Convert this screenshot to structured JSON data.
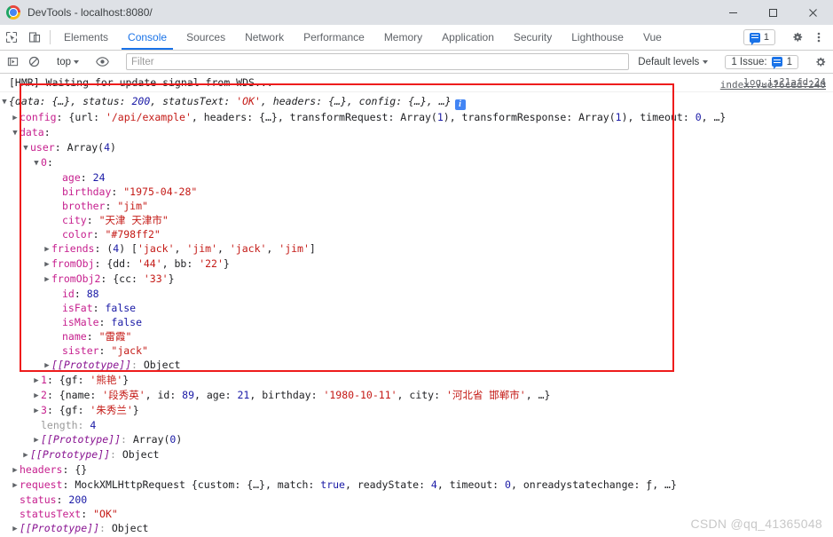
{
  "window": {
    "title": "DevTools - localhost:8080/",
    "minimize_label": "Minimize",
    "maximize_label": "Maximize",
    "close_label": "Close"
  },
  "tabbar": {
    "inspect_icon": "inspect-element-icon",
    "device_icon": "device-toolbar-icon",
    "tabs": [
      {
        "label": "Elements",
        "active": false
      },
      {
        "label": "Console",
        "active": true
      },
      {
        "label": "Sources",
        "active": false
      },
      {
        "label": "Network",
        "active": false
      },
      {
        "label": "Performance",
        "active": false
      },
      {
        "label": "Memory",
        "active": false
      },
      {
        "label": "Application",
        "active": false
      },
      {
        "label": "Security",
        "active": false
      },
      {
        "label": "Lighthouse",
        "active": false
      },
      {
        "label": "Vue",
        "active": false
      }
    ],
    "message_count": "1",
    "settings_icon": "gear-icon",
    "more_icon": "kebab-menu-icon"
  },
  "filterbar": {
    "execute_icon": "execute-snippet-icon",
    "clear_icon": "clear-console-icon",
    "context": "top",
    "eye_icon": "live-expression-icon",
    "filter_placeholder": "Filter",
    "filter_value": "",
    "levels": "Default levels",
    "issues_label": "1 Issue:",
    "issues_count": "1",
    "console_settings_icon": "gear-icon"
  },
  "console": {
    "hmr_message": "[HMR] Waiting for update signal from WDS...",
    "hmr_source": "log.js?1afd:24",
    "object_source": "index.vue?6ced:240",
    "summary": {
      "prefix": "{data: {…}, status: ",
      "status": "200",
      "mid": ", statusText: ",
      "statusText": "'OK'",
      "suffix": ", headers: {…}, config: {…}, …}",
      "info_badge": "i"
    },
    "rows": [
      {
        "indent": 1,
        "arrow": "closed",
        "name": "config",
        "sep": ": ",
        "value": "{url: '/api/example', headers: {…}, transformRequest: Array(1), transformResponse: Array(1), timeout: 0, …}"
      },
      {
        "indent": 1,
        "arrow": "open",
        "name": "data",
        "sep": ":",
        "value": ""
      },
      {
        "indent": 2,
        "arrow": "open",
        "name": "user",
        "sep": ": ",
        "value": "Array(4)"
      },
      {
        "indent": 3,
        "arrow": "open",
        "name": "0",
        "sep": ":",
        "value": ""
      },
      {
        "indent": 5,
        "arrow": "none",
        "name": "age",
        "sep": ": ",
        "value": "24"
      },
      {
        "indent": 5,
        "arrow": "none",
        "name": "birthday",
        "sep": ": ",
        "value": "\"1975-04-28\""
      },
      {
        "indent": 5,
        "arrow": "none",
        "name": "brother",
        "sep": ": ",
        "value": "\"jim\""
      },
      {
        "indent": 5,
        "arrow": "none",
        "name": "city",
        "sep": ": ",
        "value": "\"天津 天津市\""
      },
      {
        "indent": 5,
        "arrow": "none",
        "name": "color",
        "sep": ": ",
        "value": "\"#798ff2\""
      },
      {
        "indent": 4,
        "arrow": "closed",
        "name": "friends",
        "sep": ": ",
        "value": "(4) ['jack', 'jim', 'jack', 'jim']"
      },
      {
        "indent": 4,
        "arrow": "closed",
        "name": "fromObj",
        "sep": ": ",
        "value": "{dd: '44', bb: '22'}"
      },
      {
        "indent": 4,
        "arrow": "closed",
        "name": "fromObj2",
        "sep": ": ",
        "value": "{cc: '33'}"
      },
      {
        "indent": 5,
        "arrow": "none",
        "name": "id",
        "sep": ": ",
        "value": "88"
      },
      {
        "indent": 5,
        "arrow": "none",
        "name": "isFat",
        "sep": ": ",
        "value": "false"
      },
      {
        "indent": 5,
        "arrow": "none",
        "name": "isMale",
        "sep": ": ",
        "value": "false"
      },
      {
        "indent": 5,
        "arrow": "none",
        "name": "name",
        "sep": ": ",
        "value": "\"雷霞\""
      },
      {
        "indent": 5,
        "arrow": "none",
        "name": "sister",
        "sep": ": ",
        "value": "\"jack\""
      },
      {
        "indent": 4,
        "arrow": "closed",
        "name": "[[Prototype]]",
        "sep": ": ",
        "value": "Object"
      },
      {
        "indent": 3,
        "arrow": "closed",
        "name": "1",
        "sep": ": ",
        "value": "{gf: '熊艳'}"
      },
      {
        "indent": 3,
        "arrow": "closed",
        "name": "2",
        "sep": ": ",
        "value": "{name: '段秀英', id: 89, age: 21, birthday: '1980-10-11', city: '河北省 邯郸市', …}"
      },
      {
        "indent": 3,
        "arrow": "closed",
        "name": "3",
        "sep": ": ",
        "value": "{gf: '朱秀兰'}"
      },
      {
        "indent": 3,
        "arrow": "none",
        "name": "length",
        "sep": ": ",
        "value": "4"
      },
      {
        "indent": 3,
        "arrow": "closed",
        "name": "[[Prototype]]",
        "sep": ": ",
        "value": "Array(0)"
      },
      {
        "indent": 2,
        "arrow": "closed",
        "name": "[[Prototype]]",
        "sep": ": ",
        "value": "Object"
      },
      {
        "indent": 1,
        "arrow": "closed",
        "name": "headers",
        "sep": ": ",
        "value": "{}"
      },
      {
        "indent": 1,
        "arrow": "closed",
        "name": "request",
        "sep": ": ",
        "value": "MockXMLHttpRequest {custom: {…}, match: true, readyState: 4, timeout: 0, onreadystatechange: ƒ, …}"
      },
      {
        "indent": 1,
        "arrow": "none",
        "name": "status",
        "sep": ": ",
        "value": "200"
      },
      {
        "indent": 1,
        "arrow": "none",
        "name": "statusText",
        "sep": ": ",
        "value": "\"OK\""
      },
      {
        "indent": 1,
        "arrow": "closed",
        "name": "[[Prototype]]",
        "sep": ": ",
        "value": "Object"
      }
    ]
  },
  "annotations": {
    "highlight_color": "#ee1c1c"
  },
  "watermark": "CSDN @qq_41365048"
}
